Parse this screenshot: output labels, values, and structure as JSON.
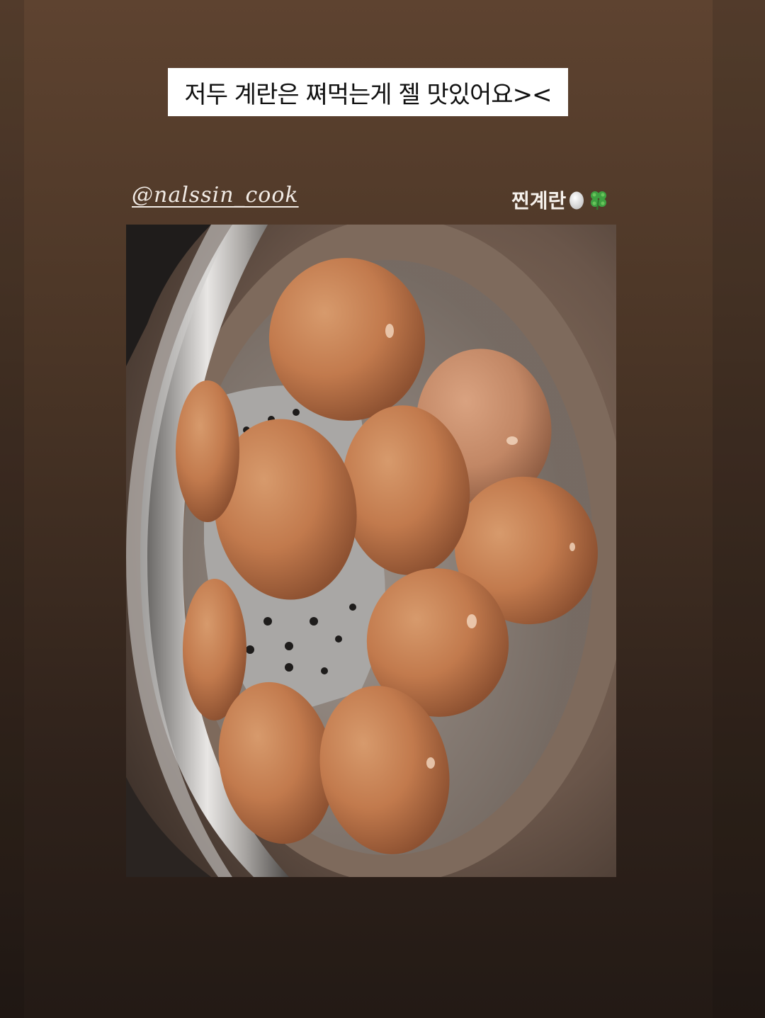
{
  "story": {
    "caption": "저두 계란은 쪄먹는게 젤 맛있어요><",
    "mention": "@nalssin_cook",
    "tag_text": "찐계란",
    "tag_emojis": [
      "egg-icon",
      "four-leaf-clover-icon"
    ]
  },
  "photo": {
    "subject": "steamed-eggs-in-steamer-pot",
    "egg_count": 10
  },
  "colors": {
    "background_top": "#5e4330",
    "background_bottom": "#231a15",
    "caption_bg": "#ffffff",
    "egg_shell": "#c17a4e"
  }
}
